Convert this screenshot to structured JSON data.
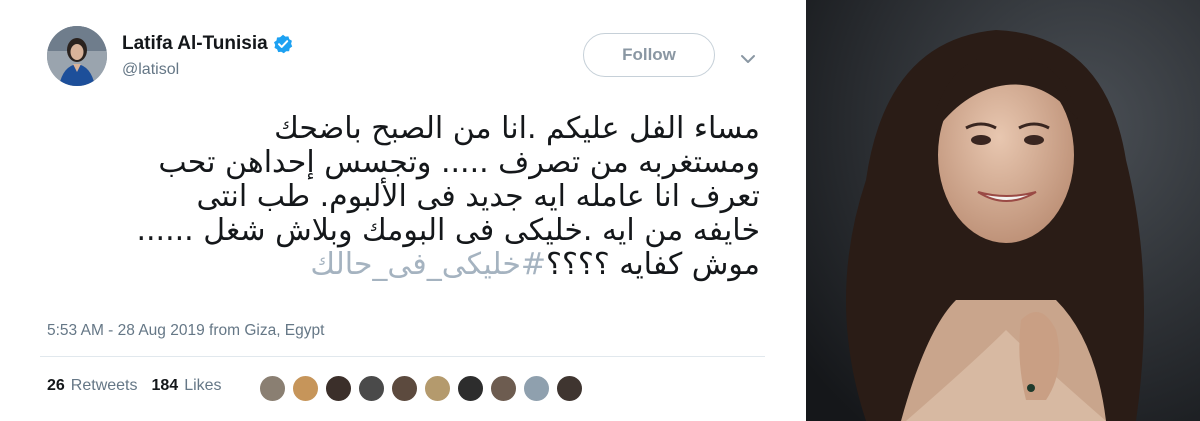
{
  "tweet": {
    "author_name": "Latifa Al-Tunisia",
    "handle": "@latisol",
    "follow_label": "Follow",
    "lines": [
      "مساء الفل عليكم .انا من  الصبح باضحك",
      "ومستغربه من تصرف ..... وتجسس إحداهن تحب",
      "تعرف انا عامله ايه جديد فى الألبوم.  طب انتى",
      "خايفه من ايه .خليكى فى البومك وبلاش شغل ......"
    ],
    "last_line_text": "موش كفايه ؟؟؟؟",
    "hashtag": "#خليكى_فى_حالك",
    "timestamp": "5:53 AM - 28 Aug 2019 from",
    "location": "Giza, Egypt",
    "retweets_count": "26",
    "retweets_label": "Retweets",
    "likes_count": "184",
    "likes_label": "Likes",
    "liker_avatar_colors": [
      "#8a7f72",
      "#c6955a",
      "#3b2f2a",
      "#4a4a4a",
      "#5c4a3e",
      "#b49a6d",
      "#2d2d2d",
      "#6d5c50",
      "#8fa0ae",
      "#3f3530"
    ]
  },
  "colors": {
    "accent_verified": "#1da1f2",
    "hashtag": "#a5b3c0",
    "text_primary": "#14171a",
    "text_secondary": "#657786"
  },
  "icons": {
    "verified": "verified-badge-icon",
    "chevron": "chevron-down-icon"
  }
}
